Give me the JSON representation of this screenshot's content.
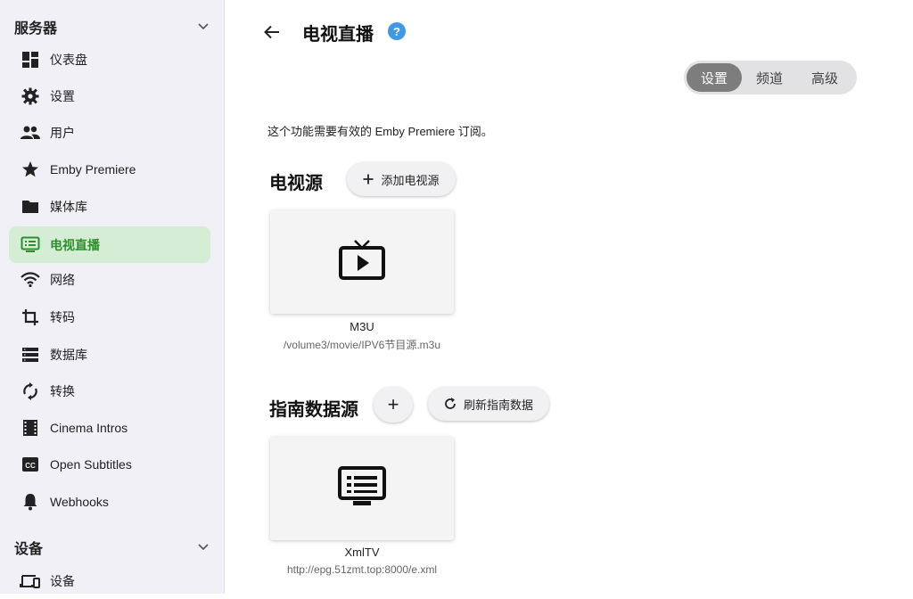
{
  "sidebar": {
    "server_section": "服务器",
    "devices_section": "设备",
    "items": [
      {
        "label": "仪表盘",
        "icon": "dashboard-icon"
      },
      {
        "label": "设置",
        "icon": "gear-icon"
      },
      {
        "label": "用户",
        "icon": "users-icon"
      },
      {
        "label": "Emby Premiere",
        "icon": "star-icon"
      },
      {
        "label": "媒体库",
        "icon": "folder-icon"
      },
      {
        "label": "电视直播",
        "icon": "live-tv-icon",
        "active": true
      },
      {
        "label": "网络",
        "icon": "wifi-icon"
      },
      {
        "label": "转码",
        "icon": "crop-icon"
      },
      {
        "label": "数据库",
        "icon": "database-icon"
      },
      {
        "label": "转换",
        "icon": "sync-icon"
      },
      {
        "label": "Cinema Intros",
        "icon": "film-icon"
      },
      {
        "label": "Open Subtitles",
        "icon": "cc-icon"
      },
      {
        "label": "Webhooks",
        "icon": "bell-icon"
      }
    ],
    "device_items": [
      {
        "label": "设备",
        "icon": "devices-icon"
      }
    ]
  },
  "header": {
    "title": "电视直播",
    "help": "?"
  },
  "tabs": [
    {
      "label": "设置",
      "active": true
    },
    {
      "label": "频道"
    },
    {
      "label": "高级"
    }
  ],
  "notice": "这个功能需要有效的 Emby Premiere 订阅。",
  "tv_sources": {
    "heading": "电视源",
    "add_button": "添加电视源",
    "cards": [
      {
        "name": "M3U",
        "path": "/volume3/movie/IPV6节目源.m3u",
        "icon": "tv-play-icon"
      }
    ]
  },
  "guide_sources": {
    "heading": "指南数据源",
    "add_symbol": "+",
    "refresh_button": "刷新指南数据",
    "cards": [
      {
        "name": "XmlTV",
        "path": "http://epg.51zmt.top:8000/e.xml",
        "icon": "guide-icon"
      }
    ]
  },
  "colors": {
    "accent": "#2f8f2f",
    "active_bg": "#d5ecd5",
    "help": "#3f9ae3",
    "sidebar_bg": "#f1f0f6"
  }
}
